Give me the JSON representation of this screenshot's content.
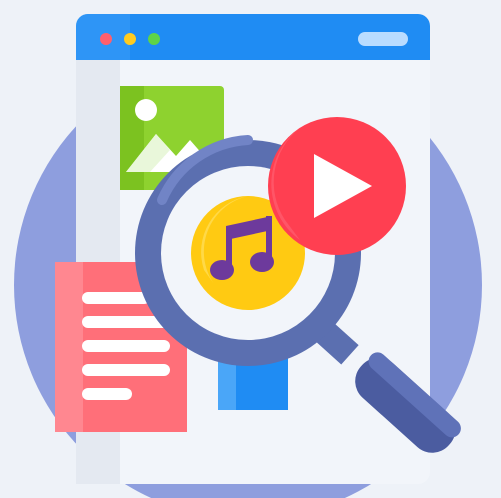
{
  "illustration": {
    "subject": "media-search",
    "icons": [
      "browser-window-icon",
      "image-icon",
      "document-icon",
      "magnifier-icon",
      "music-note-icon",
      "play-icon"
    ]
  },
  "colors": {
    "page_background": "#eef2f8",
    "backdrop_circle": "#8e9ede",
    "window_frame": "#1f8cf3",
    "window_body": "#f2f5fa",
    "window_sidebar": "#e4e9f1",
    "dot_red": "#ff5f6d",
    "dot_yellow": "#ffcb1f",
    "dot_green": "#5ed348",
    "address_pill": "#b9dcff",
    "image_card": "#8ed22f",
    "document_card": "#ff6f79",
    "magnifier_ring": "#5b6fb0",
    "magnifier_handle": "#4b5ca0",
    "music_coin": "#ffca12",
    "music_note": "#6d3a9c",
    "play_button": "#ff3f51",
    "play_triangle": "#ffffff",
    "blue_bar": "#1f8cf3"
  }
}
